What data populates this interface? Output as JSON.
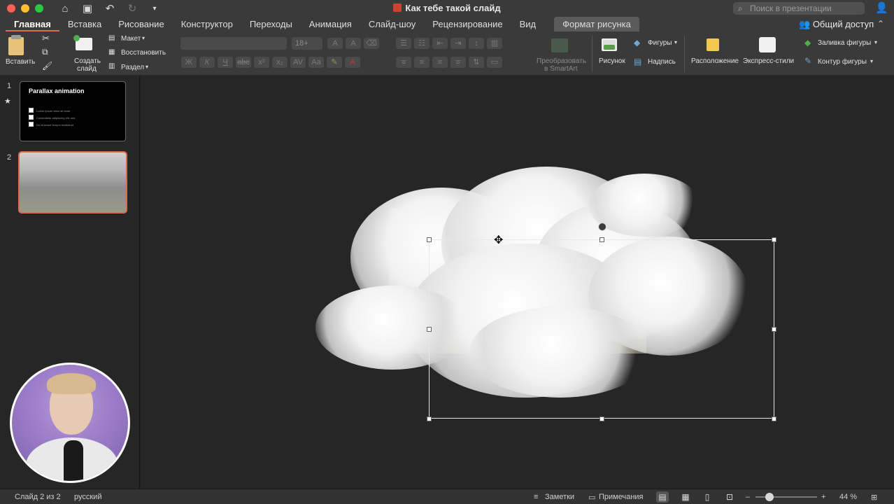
{
  "window": {
    "title": "Как тебе такой слайд",
    "search_placeholder": "Поиск в презентации"
  },
  "tabs": [
    {
      "label": "Главная"
    },
    {
      "label": "Вставка"
    },
    {
      "label": "Рисование"
    },
    {
      "label": "Конструктор"
    },
    {
      "label": "Переходы"
    },
    {
      "label": "Анимация"
    },
    {
      "label": "Слайд-шоу"
    },
    {
      "label": "Рецензирование"
    },
    {
      "label": "Вид"
    },
    {
      "label": "Формат рисунка"
    }
  ],
  "share_label": "Общий доступ",
  "ribbon": {
    "paste": "Вставить",
    "new_slide_1": "Создать",
    "new_slide_2": "слайд",
    "layout": "Макет",
    "reset": "Восстановить",
    "section": "Раздел",
    "font_size": "18+",
    "smartart_1": "Преобразовать",
    "smartart_2": "в SmartArt",
    "picture": "Рисунок",
    "shapes": "Фигуры",
    "textbox": "Надпись",
    "arrange": "Расположение",
    "quick_styles": "Экспресс-стили",
    "shape_fill": "Заливка фигуры",
    "shape_outline": "Контур фигуры"
  },
  "slides": [
    {
      "number": "1",
      "title": "Parallax animation",
      "bullets": [
        "Lorem ipsum dolor sit amet",
        "Consectetur adipiscing elit, sed",
        "Do eiusmod tempor incididunt"
      ]
    },
    {
      "number": "2"
    }
  ],
  "status": {
    "slide_of": "Слайд 2 из 2",
    "language": "русский",
    "notes": "Заметки",
    "comments": "Примечания",
    "zoom": "44 %",
    "zoom_level_percent": 44
  }
}
